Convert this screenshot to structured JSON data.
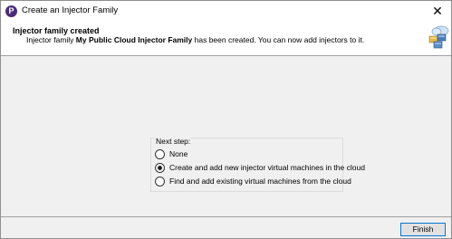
{
  "window": {
    "title": "Create an Injector Family",
    "close_glyph": "✕"
  },
  "header": {
    "title": "Injector family created",
    "desc_prefix": "Injector family ",
    "family_name": "My Public Cloud Injector Family",
    "desc_suffix": " has been created. You can now add injectors to it."
  },
  "next_step": {
    "legend": "Next step:",
    "options": [
      {
        "label": "None",
        "checked": false
      },
      {
        "label": "Create and add new injector virtual machines in the cloud",
        "checked": true
      },
      {
        "label": "Find and add existing virtual machines from the cloud",
        "checked": false
      }
    ]
  },
  "footer": {
    "finish_label": "Finish"
  },
  "icons": {
    "app_icon": "app-logo-icon",
    "header_icon": "cloud-injectors-icon"
  },
  "colors": {
    "app_icon_bg": "#4b2c7a",
    "finish_border": "#0078d7"
  }
}
